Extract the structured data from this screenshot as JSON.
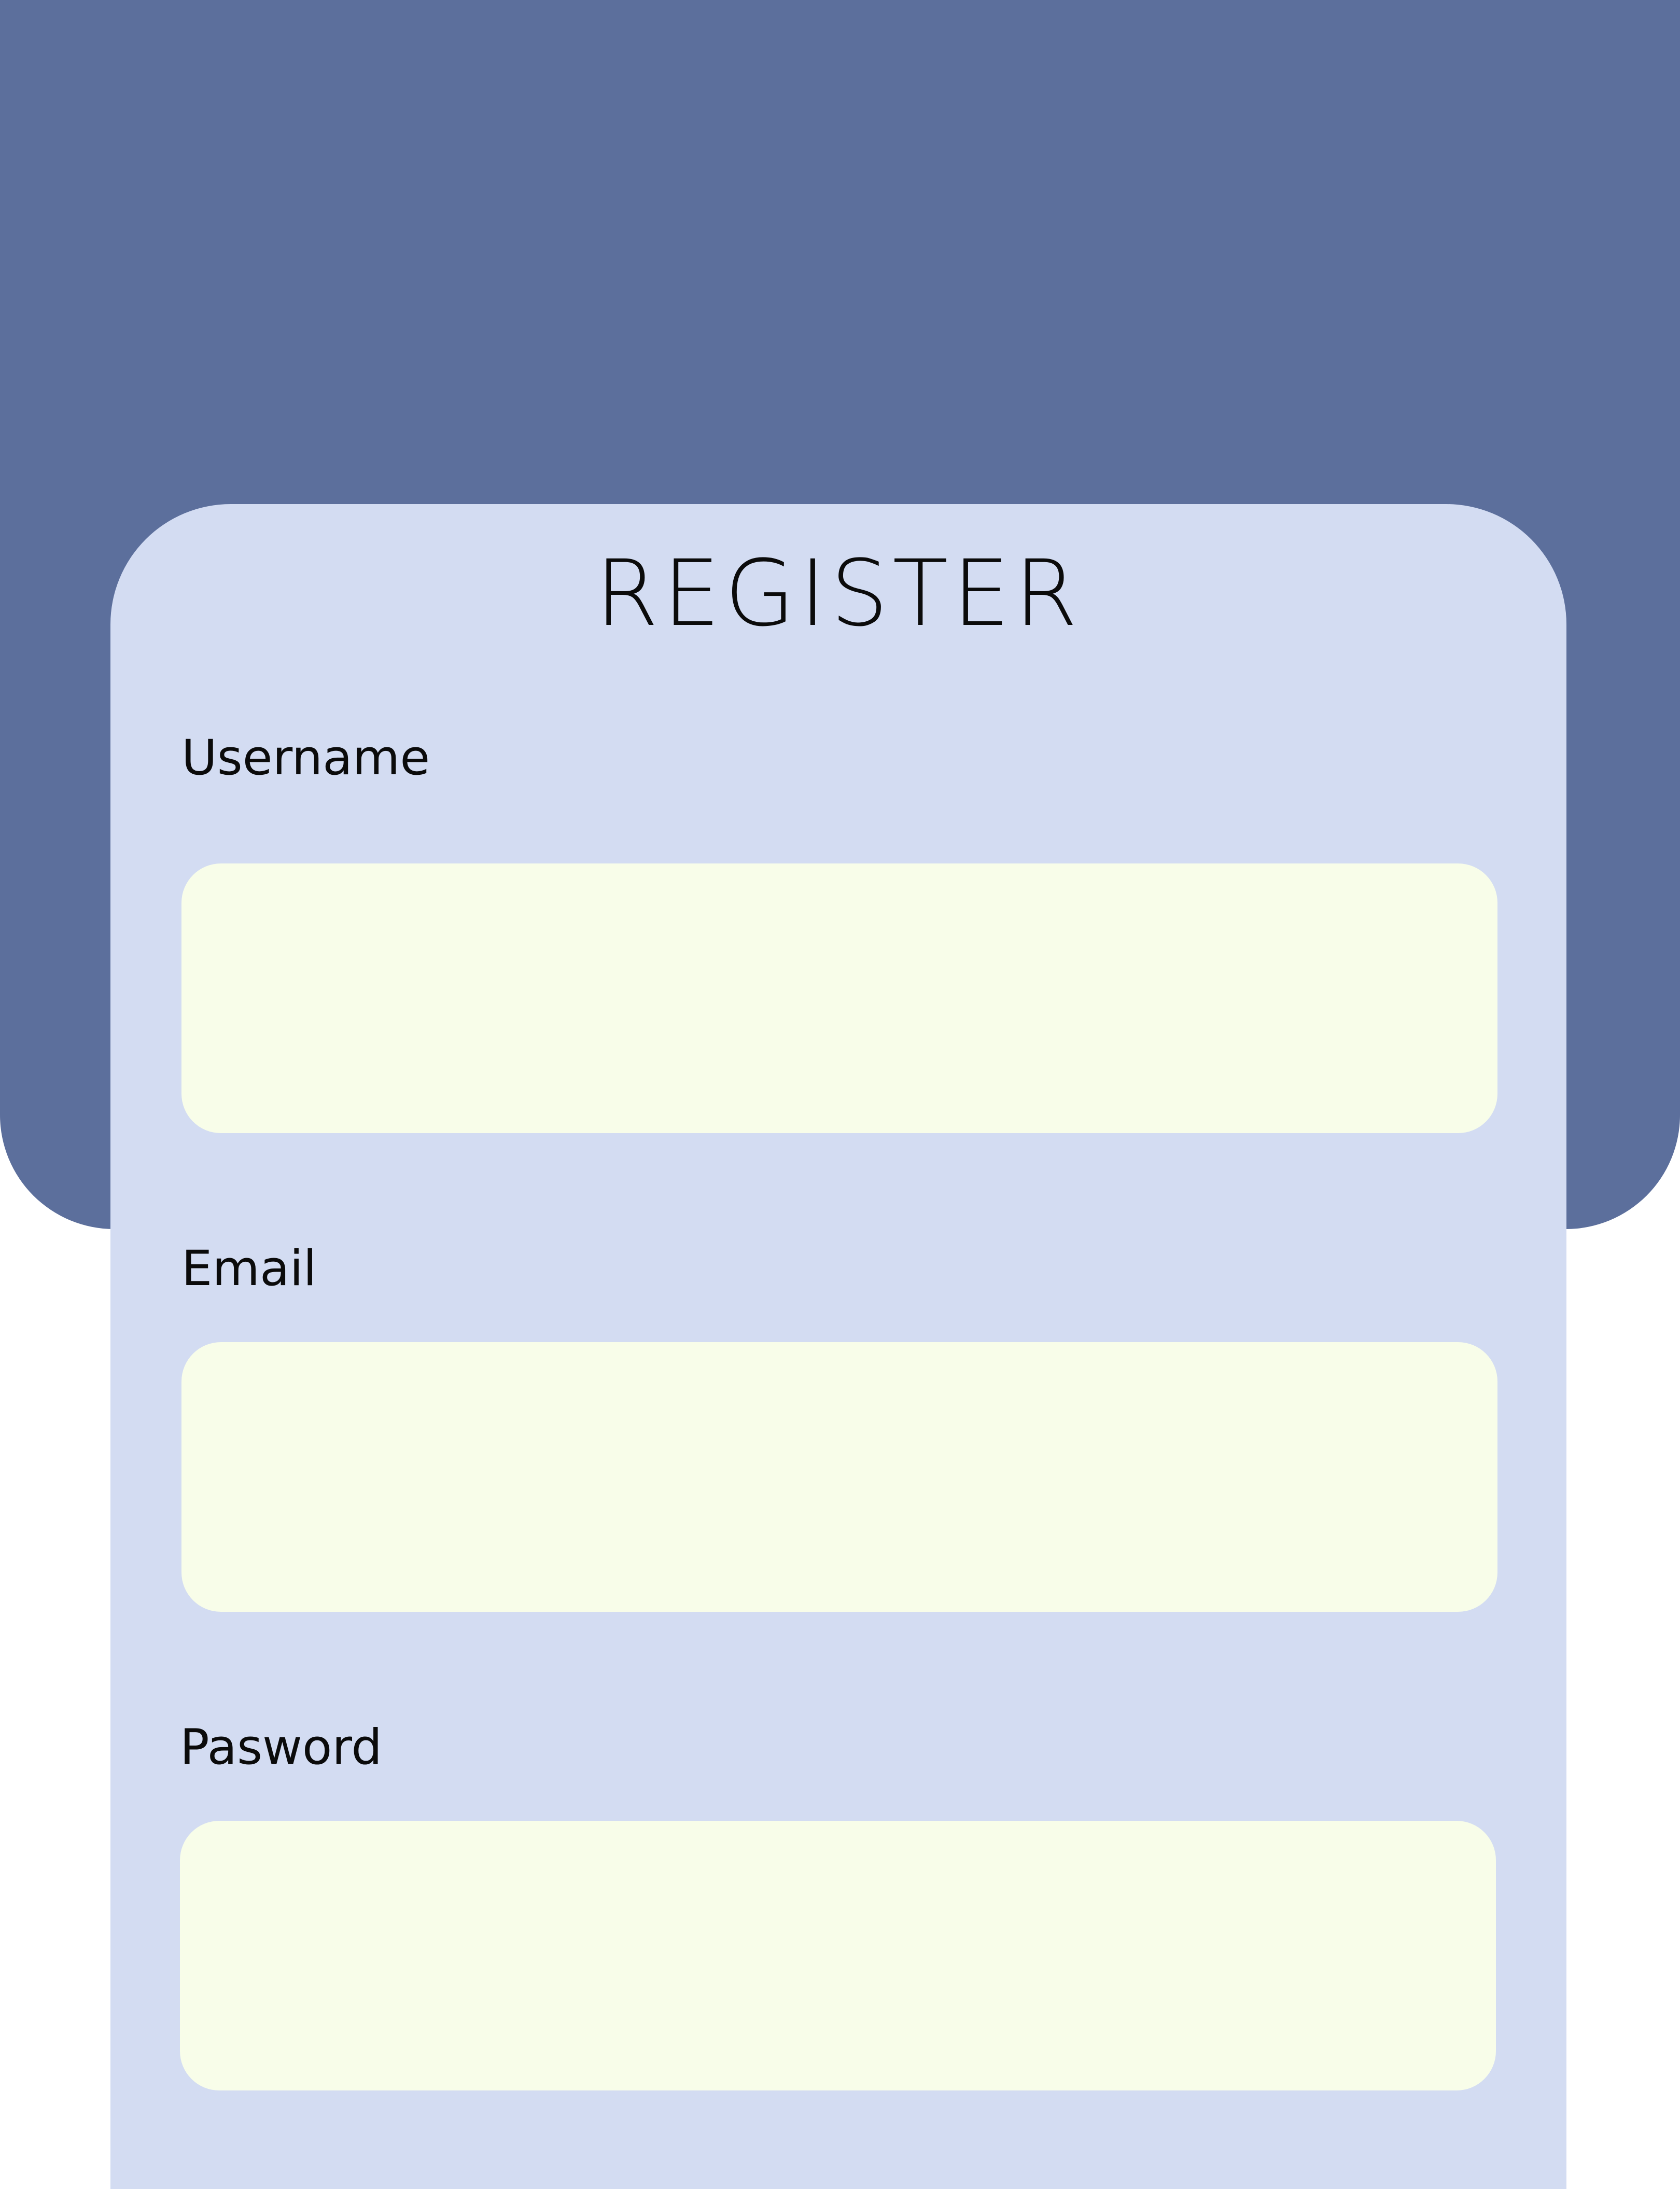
{
  "form": {
    "title": "REGISTER",
    "fields": [
      {
        "label": "Username",
        "value": "",
        "placeholder": ""
      },
      {
        "label": "Email",
        "value": "",
        "placeholder": ""
      },
      {
        "label": "Pasword",
        "value": "",
        "placeholder": ""
      }
    ]
  },
  "colors": {
    "header_background": "#5c6f9c",
    "card_background": "#d3dcf2",
    "input_background": "#f8fde9",
    "text": "#0b0b0b"
  }
}
